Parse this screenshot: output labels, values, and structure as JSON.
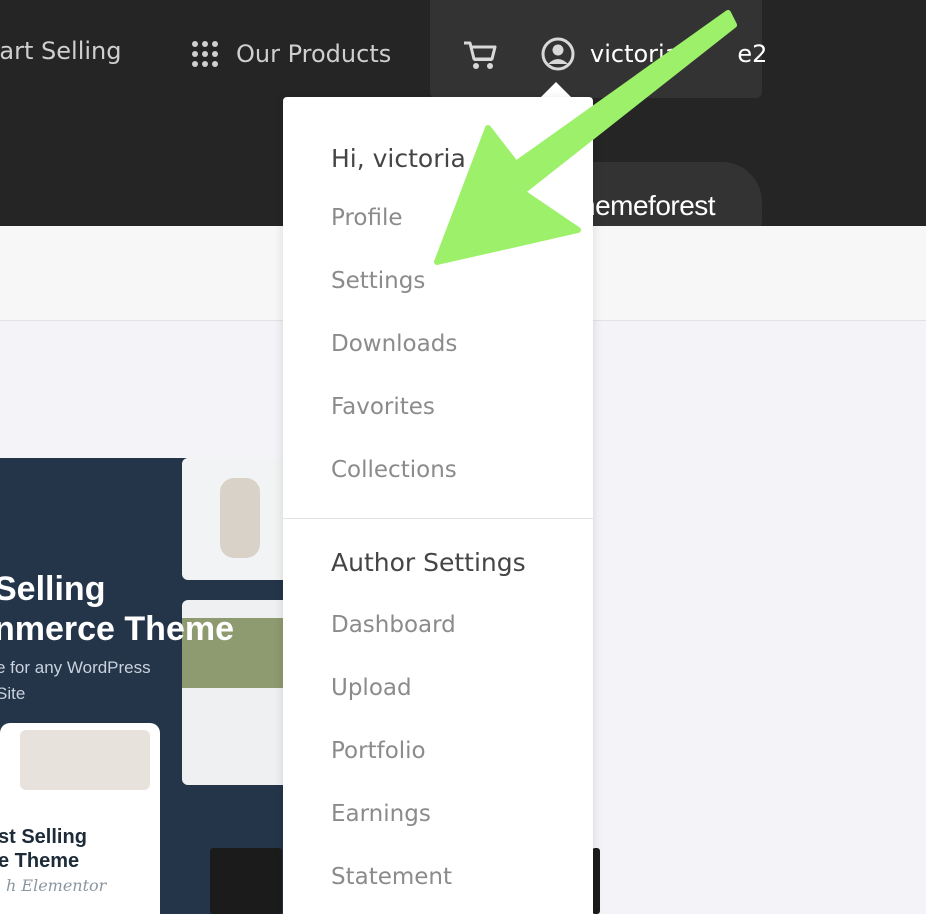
{
  "nav": {
    "start_selling": "tart Selling",
    "our_products": "Our Products",
    "username": "victoria",
    "username_tail": "e2"
  },
  "brand": {
    "name": "hemeforest"
  },
  "dropdown": {
    "greeting": "Hi, victoria",
    "account_items": [
      "Profile",
      "Settings",
      "Downloads",
      "Favorites",
      "Collections"
    ],
    "author_heading": "Author Settings",
    "author_items": [
      "Dashboard",
      "Upload",
      "Portfolio",
      "Earnings",
      "Statement"
    ]
  },
  "banner": {
    "title_line1": "Selling",
    "title_line2": "nmerce Theme",
    "subtitle_line1": "e for any WordPress",
    "subtitle_line2": "Site",
    "card_line1": "st Selling",
    "card_line2": "e Theme",
    "card_script": "h Elementor"
  },
  "colors": {
    "topbar": "#252525",
    "account_box": "#333333",
    "annotation_arrow": "#9df069"
  },
  "icons": [
    "grid-dots-icon",
    "cart-icon",
    "user-avatar-icon"
  ]
}
